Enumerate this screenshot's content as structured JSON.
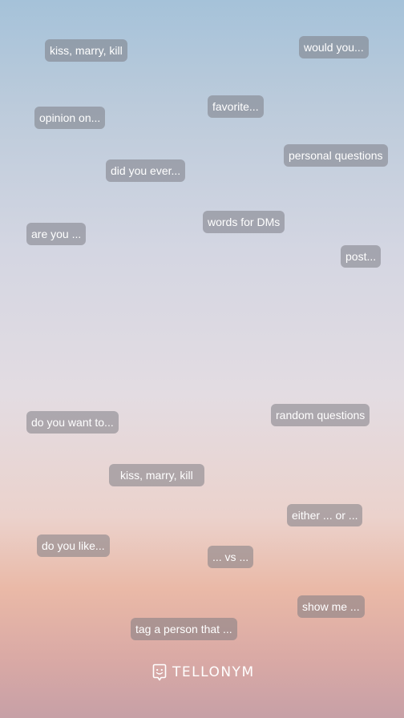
{
  "prompts": [
    "kiss, marry, kill",
    "would you...",
    "opinion on...",
    "favorite...",
    "personal questions",
    "did you ever...",
    "words for DMs",
    "are you ...",
    "post...",
    "do you want to...",
    "random questions",
    "kiss, marry, kill",
    "either ... or ...",
    "do you like...",
    "... vs ...",
    "show me ...",
    "tag a person that ..."
  ],
  "brand": {
    "name": "TELLONYM",
    "icon": "tellonym-logo-icon"
  }
}
